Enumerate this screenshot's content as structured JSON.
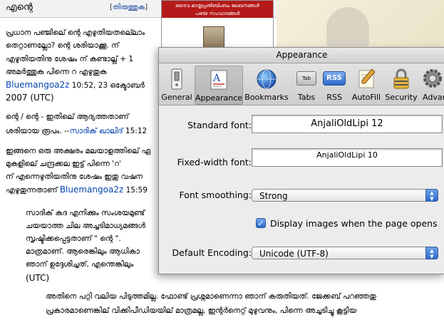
{
  "wiki": {
    "title": "എന്റെ",
    "edit_link": "തിരുത്തുക",
    "banner_line1": "ദൈവ മാതൃപ്രതിബിംബം ലേഖനങ്ങൾ",
    "banner_line2": "പഴയ സംവാദങ്ങൾ",
    "lines": [
      "പ്രധാന പഞ്ജിലെ് ന്റെ എഴുതിയതലെ്ലാം",
      "തെറ്റാണല്ലോ? ന്റെ ശരിയാക്കൂ. ന്",
      "എഴുതിയതിനു ശേഷം ന് കണ്ടാല്ല് + 1",
      "അമർത്തുക പിന്നെ റ എഴുതുക",
      "Bluemangoa2z",
      "10:52, 23 ഒക്ടോബർ",
      "2007 (UTC)",
      "ന്റെ / ന്റെ - ഇതിലെ് ആദ്യത്തതാണ്",
      "ശരിയായ രൂപം. --",
      "സാദിക് ഖാലിദ്",
      "15:12",
      "ഇങ്ങനെ ഒരു അക്ഷരം മലയാളത്തിലെ് ഏ",
      "മുകളിലെ് ചന്ദ്രക്കല ഇട്ട് പിന്നെ 'റ'",
      "ന് എന്നെഴുതിയതിനു ശേഷം ഇതു വഷന",
      "എഴുതുന്നതാണ്",
      "Bluemangoa2z",
      "15:59",
      "സാദിക് കദ എനിക്കും സംശയമുണ്ട്",
      "ചയയാത്ത ചില അച്ചടിമാധ്യമങ്ങൾ",
      "സൃഷ്ടിക്കപ്പെട്ടതാണ് \" ന്റെ \".",
      "മാത്രമാണ്. ആരെങ്കിലും ആധികാ",
      "ഞാന് ഉദ്ദേശിച്ചത്, എന്തെങ്കിലും",
      "(UTC)",
      "അതിനെ പറ്റി വലിയ പിടുത്തമില്ല. ഫോണ്ട് പ്രശ്നമാണെന്നാ ഞാന് കരുതിയത്. ജേക്കബ് പറഞ്ഞതു",
      "പ്രകാരമാണെങ്കില് വിക്കിപീഡിയയില് മാത്രമല്ല, ഇന്റർനെറ്റ് മുഴുവനും, പിന്നെ അച്ചടിച്ചു കൂട്ടിയ"
    ]
  },
  "prefs": {
    "window_title": "Appearance",
    "toolbar": [
      {
        "label": "General",
        "icon": "general-switch-icon"
      },
      {
        "label": "Appearance",
        "icon": "appearance-font-icon",
        "selected": true
      },
      {
        "label": "Bookmarks",
        "icon": "globe-icon"
      },
      {
        "label": "Tabs",
        "icon": "tabs-icon"
      },
      {
        "label": "RSS",
        "icon": "rss-icon"
      },
      {
        "label": "AutoFill",
        "icon": "autofill-pencil-icon"
      },
      {
        "label": "Security",
        "icon": "lock-icon"
      },
      {
        "label": "Advan",
        "icon": "gear-icon"
      }
    ],
    "tabs_icon_text": "Tab",
    "rss_icon_text": "RSS",
    "standard_font_label": "Standard font:",
    "standard_font_value": "AnjaliOldLipi 12",
    "fixed_font_label": "Fixed-width font:",
    "fixed_font_value": "AnjaliOldLipi 10",
    "font_smoothing_label": "Font smoothing:",
    "font_smoothing_value": "Strong",
    "display_images_label": "Display images when the page opens",
    "display_images_checked": true,
    "check_mark": "✓",
    "default_encoding_label": "Default Encoding:",
    "default_encoding_value": "Unicode (UTF-8)"
  },
  "colors": {
    "popup_accent": "#2c6bd0",
    "banner_red": "#b51919",
    "link_blue": "#0645ad"
  }
}
